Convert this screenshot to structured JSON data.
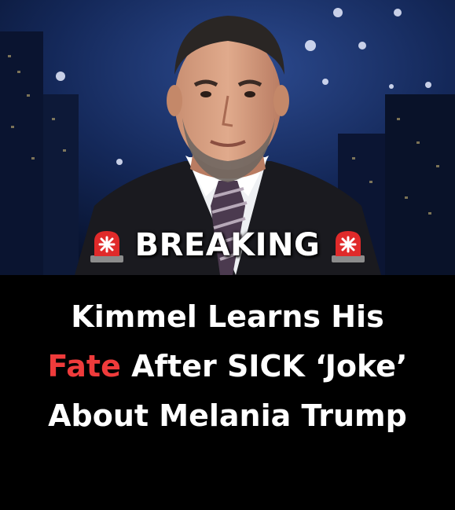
{
  "banner": {
    "left_icon": "police-siren-emoji",
    "text": "BREAKING",
    "right_icon": "police-siren-emoji"
  },
  "headline": {
    "line1": "Kimmel Learns His",
    "line2_highlight": "Fate",
    "line2_rest": " After SICK ‘Joke’",
    "line3": "About Melania Trump"
  },
  "colors": {
    "background": "#000000",
    "headline_text": "#ffffff",
    "highlight": "#ef3b3b",
    "siren_red": "#e02a2a"
  }
}
